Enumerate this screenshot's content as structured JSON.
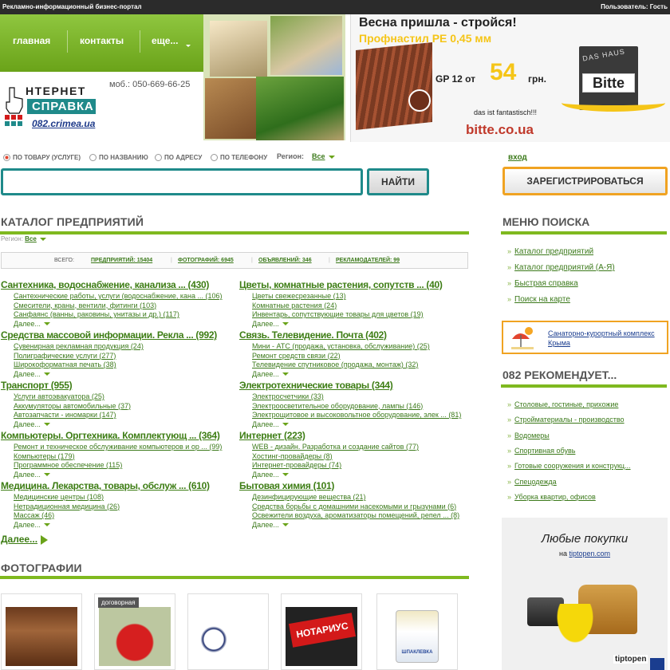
{
  "topbar": {
    "left": "Рекламно-информационный бизнес-портал",
    "right": "Пользователь: Гость"
  },
  "nav": {
    "items": [
      "главная",
      "контакты",
      "еще..."
    ]
  },
  "logo": {
    "line1": "НТЕРНЕТ",
    "line2": "СПРАВКА",
    "line3": "082.crimea.ua"
  },
  "phone": "моб.: 050-669-66-25",
  "banner": {
    "headline": "Весна пришла - стройся!",
    "product": "Профнастил РЕ 0,45 мм",
    "price_prefix": "GP 12 от",
    "price": "54",
    "price_suffix": "грн.",
    "brand_top": "DAS HAUS",
    "brand": "Bitte",
    "slogan": "das ist fantastisch!!!",
    "url": "bitte.co.ua"
  },
  "search": {
    "options": [
      "ПО ТОВАРУ (УСЛУГЕ)",
      "ПО НАЗВАНИЮ",
      "ПО АДРЕСУ",
      "ПО ТЕЛЕФОНУ"
    ],
    "region_label": "Регион:",
    "region_value": "Все",
    "button": "НАЙТИ",
    "login": "вход",
    "register": "ЗАРЕГИСТРИРОВАТЬСЯ"
  },
  "catalog": {
    "title": "КАТАЛОГ ПРЕДПРИЯТИЙ",
    "region_label": "Регион:",
    "region_value": "Все",
    "stats": {
      "total": "ВСЕГО:",
      "enterprises": "ПРЕДПРИЯТИЙ: 15404",
      "photos": "ФОТОГРАФИЙ: 6945",
      "ads": "ОБЪЯВЛЕНИЙ: 346",
      "advertisers": "РЕКЛАМОДАТЕЛЕЙ: 99"
    },
    "more_label": "Далее...",
    "categories": [
      {
        "title": "Сантехника, водоснабжение, канализа ... (430)",
        "subs": [
          "Сантехнические работы, услуги (водоснабжение, кана ... (106)",
          "Смесители, краны, вентили, фитинги (103)",
          "Санфаянс (ванны, раковины, унитазы и др.) (117)"
        ]
      },
      {
        "title": "Цветы, комнатные растения, сопутств ... (40)",
        "subs": [
          "Цветы свежесрезанные (13)",
          "Комнатные растения (24)",
          "Инвентарь, сопутствующие товары для цветов (19)"
        ]
      },
      {
        "title": "Средства массовой информации. Рекла ... (992)",
        "subs": [
          "Сувенирная рекламная продукция (24)",
          "Полиграфические услуги (277)",
          "Широкоформатная печать (38)"
        ]
      },
      {
        "title": "Связь. Телевидение. Почта (402)",
        "subs": [
          "Мини - АТС (продажа, установка, обслуживание) (25)",
          "Ремонт средств связи (22)",
          "Телевидение спутниковое (продажа, монтаж) (32)"
        ]
      },
      {
        "title": "Транспорт (955)",
        "subs": [
          "Услуги автоэвакуатора (25)",
          "Аккумуляторы автомобильные (37)",
          "Автозапчасти - иномарки (147)"
        ]
      },
      {
        "title": "Электротехнические товары (344)",
        "subs": [
          "Электросчетчики (33)",
          "Электроосветительное оборудование, лампы (146)",
          "Электрощитовое и высоковольтное оборудование, элек ... (81)"
        ]
      },
      {
        "title": "Компьютеры. Оргтехника. Комплектующ ... (364)",
        "subs": [
          "Ремонт и техническое обслуживание компьютеров и ор ... (99)",
          "Компьютеры (179)",
          "Программное обеспечение (115)"
        ]
      },
      {
        "title": "Интернет (223)",
        "subs": [
          "WEB - дизайн. Разработка и создание сайтов (77)",
          "Хостинг-провайдеры (8)",
          "Интернет-провайдеры (74)"
        ]
      },
      {
        "title": "Медицина. Лекарства, товары, обслуж ... (610)",
        "subs": [
          "Медицинские центры (108)",
          "Нетрадиционная медицина (26)",
          "Массаж (46)"
        ]
      },
      {
        "title": "Бытовая химия (101)",
        "subs": [
          "Дезинфицирующие вещества (21)",
          "Средства борьбы с домашними насекомыми и грызунами (6)",
          "Освежители воздуха, ароматизаторы помещений, репел ... (8)"
        ]
      }
    ],
    "all_more": "Далее..."
  },
  "photos": {
    "title": "ФОТОГРАФИИ",
    "badge": "договорная",
    "sign_text": "НОТАРИУС",
    "product_text": "ШПАКЛЕВКА"
  },
  "sidebar": {
    "menu_title": "МЕНЮ ПОИСКА",
    "menu": [
      "Каталог предприятий",
      "Каталог предприятий (А-Я)",
      "Быстрая справка",
      "Поиск на карте"
    ],
    "sanatorium": "Санаторно-курортный комплекс Крыма",
    "rec_title": "082 РЕКОМЕНДУЕТ...",
    "recs": [
      "Столовые, гостиные, прихожие",
      "Стройматериалы - производство",
      "Водомеры",
      "Спортивная обувь",
      "Готовые сооружения и конструкц...",
      "Спецодежда",
      "Уборка квартир, офисов"
    ],
    "ad_title": "Любые покупки",
    "ad_prefix": "на",
    "ad_link": "tiptopen.com",
    "ad_brand": "tiptopen"
  }
}
